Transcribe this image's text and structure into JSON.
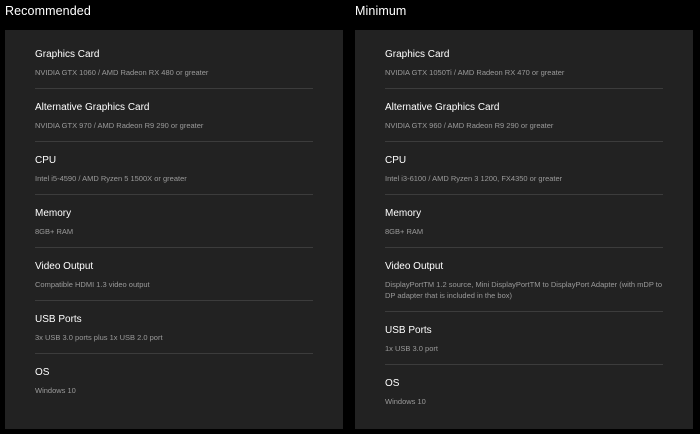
{
  "recommended": {
    "title": "Recommended",
    "specs": [
      {
        "label": "Graphics Card",
        "value": "NVIDIA GTX 1060 / AMD Radeon RX 480 or greater"
      },
      {
        "label": "Alternative Graphics Card",
        "value": "NVIDIA GTX 970 / AMD Radeon R9 290 or greater"
      },
      {
        "label": "CPU",
        "value": "Intel i5-4590 / AMD Ryzen 5 1500X or greater"
      },
      {
        "label": "Memory",
        "value": "8GB+ RAM"
      },
      {
        "label": "Video Output",
        "value": "Compatible HDMI 1.3 video output"
      },
      {
        "label": "USB Ports",
        "value": "3x USB 3.0 ports plus 1x USB 2.0 port"
      },
      {
        "label": "OS",
        "value": "Windows 10"
      }
    ]
  },
  "minimum": {
    "title": "Minimum",
    "specs": [
      {
        "label": "Graphics Card",
        "value": "NVIDIA GTX 1050Ti / AMD Radeon RX 470 or greater"
      },
      {
        "label": "Alternative Graphics Card",
        "value": "NVIDIA GTX 960 / AMD Radeon R9 290 or greater"
      },
      {
        "label": "CPU",
        "value": "Intel i3-6100 / AMD Ryzen 3 1200, FX4350 or greater"
      },
      {
        "label": "Memory",
        "value": "8GB+ RAM"
      },
      {
        "label": "Video Output",
        "value": "DisplayPortTM 1.2 source, Mini DisplayPortTM to DisplayPort Adapter (with mDP to DP adapter that is included in the box)"
      },
      {
        "label": "USB Ports",
        "value": "1x USB 3.0 port"
      },
      {
        "label": "OS",
        "value": "Windows 10"
      }
    ]
  }
}
